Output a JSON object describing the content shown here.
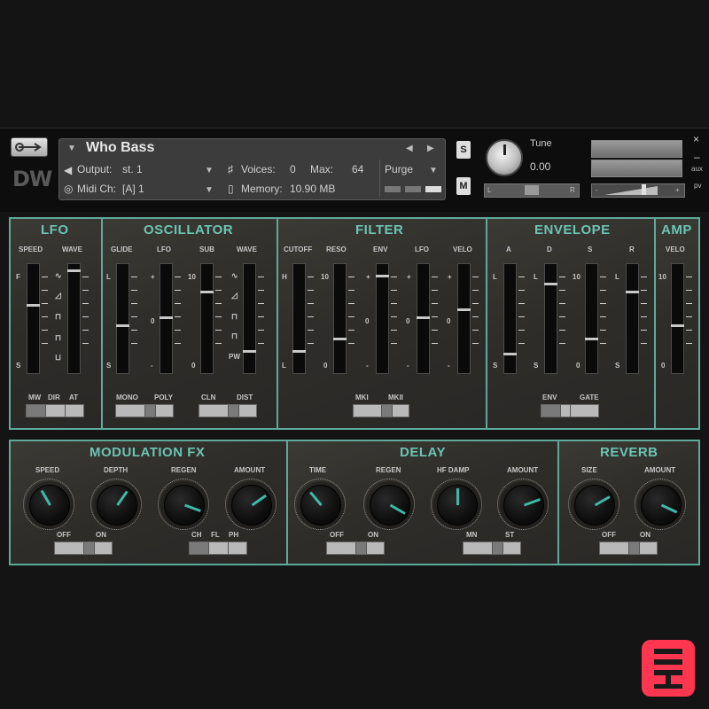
{
  "header": {
    "title": "Who Bass",
    "output_label": "Output:",
    "output_value": "st. 1",
    "voices_label": "Voices:",
    "voices_value": "0",
    "max_label": "Max:",
    "max_value": "64",
    "purge_label": "Purge",
    "midi_label": "Midi Ch:",
    "midi_value": "[A] 1",
    "memory_label": "Memory:",
    "memory_value": "10.90 MB",
    "solo_label": "S",
    "mute_label": "M",
    "tune_label": "Tune",
    "tune_value": "0.00",
    "pan_left": "L",
    "pan_right": "R",
    "close": "×",
    "minimize": "–",
    "aux": "aux",
    "pv": "pv",
    "vol_minus": "-",
    "vol_plus": "+",
    "logo": "DW"
  },
  "panels": {
    "lfo": {
      "title": "LFO",
      "labels": [
        "SPEED",
        "WAVE"
      ],
      "scale_top": "F",
      "scale_bottom": "S",
      "switch": [
        "MW",
        "DIR",
        "AT"
      ]
    },
    "oscillator": {
      "title": "OSCILLATOR",
      "labels": [
        "GLIDE",
        "LFO",
        "SUB",
        "WAVE"
      ],
      "glide_top": "L",
      "glide_bottom": "S",
      "lfo_top": "+",
      "lfo_mid": "0",
      "lfo_bottom": "-",
      "sub_top": "10",
      "sub_bottom": "0",
      "pw": "PW",
      "mono": "MONO",
      "poly": "POLY",
      "cln": "CLN",
      "dist": "DIST"
    },
    "filter": {
      "title": "FILTER",
      "labels": [
        "CUTOFF",
        "RESO",
        "ENV",
        "LFO",
        "VELO"
      ],
      "cut_top": "H",
      "cut_bottom": "L",
      "reso_top": "10",
      "reso_bottom": "0",
      "pm_top": "+",
      "pm_mid": "0",
      "pm_bottom": "-",
      "switch": [
        "MKI",
        "MKII"
      ]
    },
    "envelope": {
      "title": "ENVELOPE",
      "labels": [
        "A",
        "D",
        "S",
        "R"
      ],
      "ad_top": "L",
      "ad_bottom": "S",
      "s_top": "10",
      "s_bottom": "0",
      "switch": [
        "ENV",
        "GATE"
      ]
    },
    "amp": {
      "title": "AMP",
      "labels": [
        "VELO"
      ],
      "top": "10",
      "bottom": "0"
    },
    "modfx": {
      "title": "MODULATION FX",
      "knobs": [
        "SPEED",
        "DEPTH",
        "REGEN",
        "AMOUNT"
      ],
      "sw1": [
        "OFF",
        "ON"
      ],
      "sw2": [
        "CH",
        "FL",
        "PH"
      ]
    },
    "delay": {
      "title": "DELAY",
      "knobs": [
        "TIME",
        "REGEN",
        "HF DAMP",
        "AMOUNT"
      ],
      "sw1": [
        "OFF",
        "ON"
      ],
      "sw2": [
        "MN",
        "ST"
      ]
    },
    "reverb": {
      "title": "REVERB",
      "knobs": [
        "SIZE",
        "AMOUNT"
      ],
      "sw1": [
        "OFF",
        "ON"
      ]
    }
  },
  "accent_color": "#6cc4b3",
  "knob_indicator_color": "#3fb9a6",
  "slider_values": {
    "lfo_speed": 0.62,
    "lfo_wave": 0.95,
    "osc_glide": 0.42,
    "osc_lfo": 0.5,
    "osc_sub": 0.75,
    "osc_wave": 0.18,
    "filt_cutoff": 0.18,
    "filt_reso": 0.3,
    "filt_env": 0.9,
    "filt_lfo": 0.5,
    "filt_velo": 0.58,
    "env_a": 0.15,
    "env_d": 0.82,
    "env_s": 0.3,
    "env_r": 0.75,
    "amp_velo": 0.42
  },
  "knob_angles": {
    "mod_speed": -30,
    "mod_depth": 35,
    "mod_regen": 110,
    "mod_amount": 55,
    "del_time": -40,
    "del_regen": 120,
    "del_hfdamp": 0,
    "del_amount": 70,
    "rev_size": 60,
    "rev_amount": 115
  }
}
